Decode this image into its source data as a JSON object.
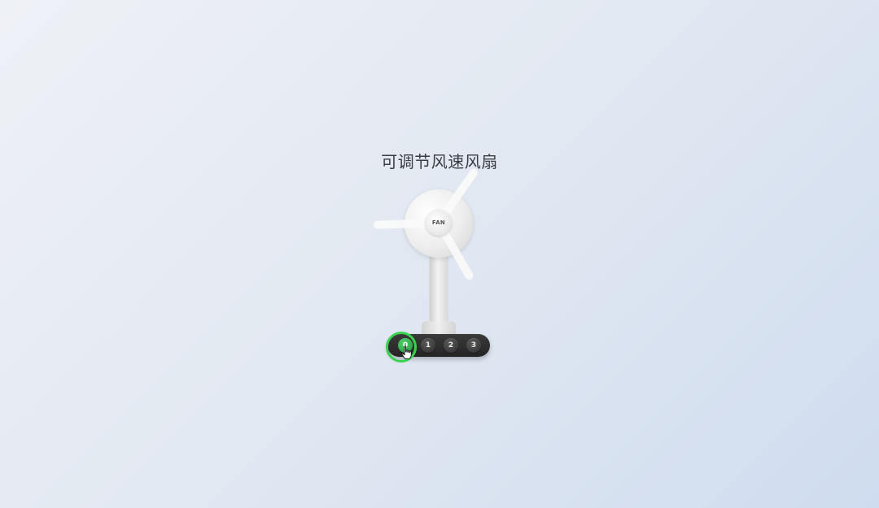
{
  "page": {
    "title": "可调节风速风扇"
  },
  "fan": {
    "brand_label": "FAN",
    "speed_buttons": [
      {
        "label": "0",
        "active": true
      },
      {
        "label": "1",
        "active": false
      },
      {
        "label": "2",
        "active": false
      },
      {
        "label": "3",
        "active": false
      }
    ],
    "colors": {
      "active": "#2fb64a",
      "panel": "#2a2a2a",
      "focus_ring": "#39d24f"
    }
  },
  "pointer": {
    "icon": "hand-pointer-icon"
  }
}
